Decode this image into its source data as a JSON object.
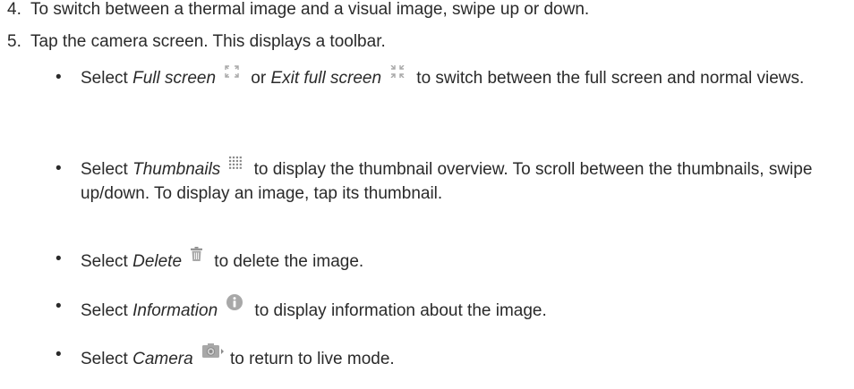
{
  "steps": [
    {
      "number": "4.",
      "text": "To switch between a thermal image and a visual image, swipe up or down."
    },
    {
      "number": "5.",
      "text": "Tap the camera screen. This displays a toolbar."
    }
  ],
  "bullets": {
    "symbol": "•",
    "full_screen": {
      "pre": "Select ",
      "term1": "Full screen",
      "mid": " or ",
      "term2": "Exit full screen",
      "post": " to switch between the full screen and normal views.",
      "icon1": "expand-icon",
      "icon2": "collapse-icon"
    },
    "thumbnails": {
      "pre": "Select ",
      "term": "Thumbnails",
      "post": " to display the thumbnail overview. To scroll between the thumbnails, swipe up/down. To display an image, tap its thumbnail.",
      "icon": "grid-icon"
    },
    "delete": {
      "pre": "Select ",
      "term": "Delete",
      "post": " to delete the image.",
      "icon": "trash-icon"
    },
    "information": {
      "pre": "Select ",
      "term": "Information",
      "post": " to display information about the image.",
      "icon": "info-icon"
    },
    "camera": {
      "pre": "Select ",
      "term": "Camera",
      "post": " to return to live mode.",
      "icon": "camera-icon"
    }
  },
  "colors": {
    "text": "#2a2a2a",
    "icon_gray": "#a8a8a8",
    "icon_dark": "#8a8a8a"
  }
}
